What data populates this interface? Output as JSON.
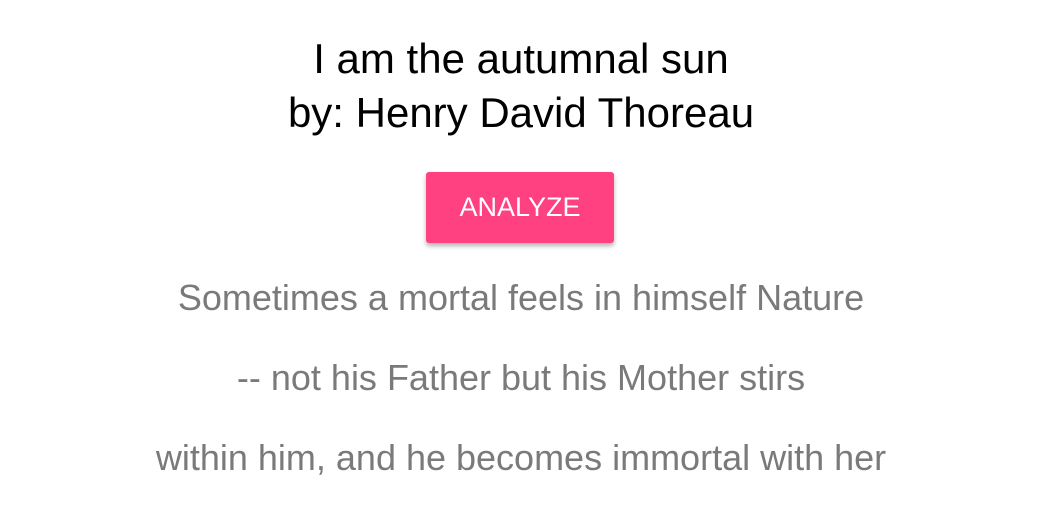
{
  "poem": {
    "title": "I am the autumnal sun",
    "author_line": "by: Henry David Thoreau",
    "lines": [
      "Sometimes a mortal feels in himself Nature",
      "-- not his Father but his Mother stirs",
      "within him, and he becomes immortal with her"
    ]
  },
  "actions": {
    "analyze_label": "ANALYZE"
  },
  "colors": {
    "accent": "#ff4081",
    "text": "#7a7a7a"
  }
}
